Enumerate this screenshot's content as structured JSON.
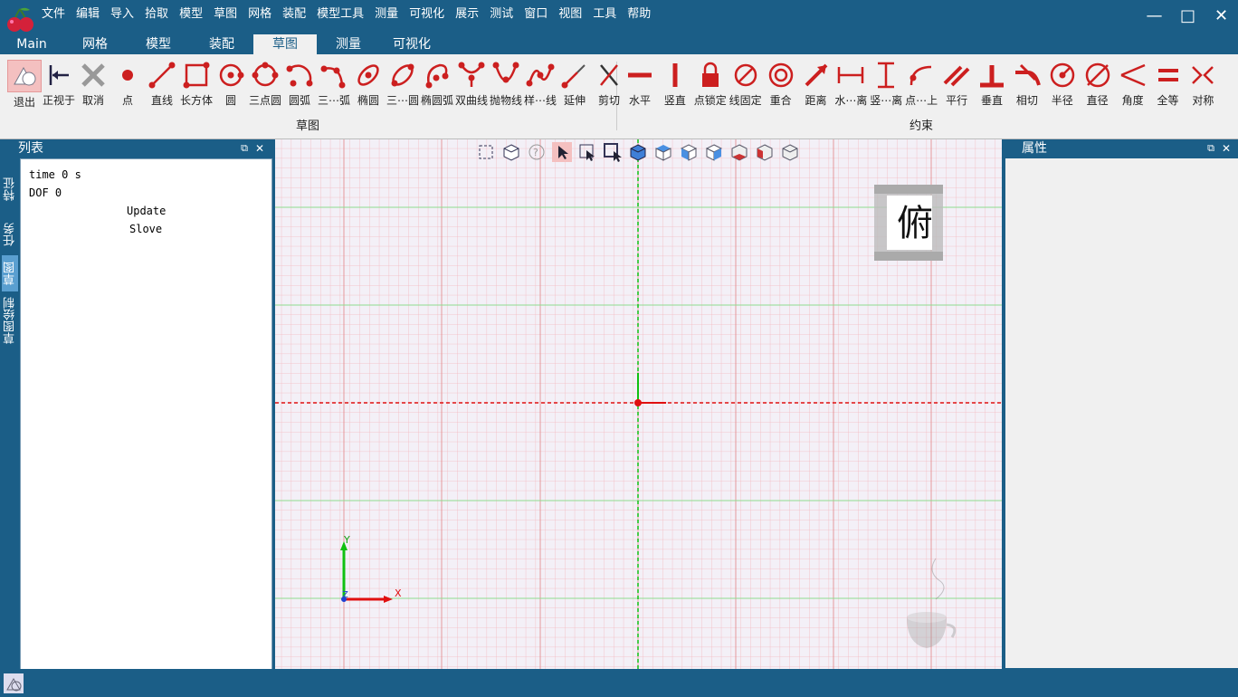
{
  "app": {
    "menu": [
      "文件",
      "编辑",
      "导入",
      "拾取",
      "模型",
      "草图",
      "网格",
      "装配",
      "模型工具",
      "测量",
      "可视化",
      "展示",
      "测试",
      "窗口",
      "视图",
      "工具",
      "帮助"
    ]
  },
  "tabs": [
    "Main",
    "网格",
    "模型",
    "装配",
    "草图",
    "测量",
    "可视化"
  ],
  "active_tab": "草图",
  "ribbon": {
    "sketch_group_label": "草图",
    "constraint_group_label": "约束",
    "sketch_buttons": [
      {
        "label": "退出",
        "icon": "exit-sketch-icon"
      },
      {
        "label": "正视于",
        "icon": "normal-to-icon"
      },
      {
        "label": "取消",
        "icon": "cancel-x-icon"
      },
      {
        "label": "点",
        "icon": "point-icon"
      },
      {
        "label": "直线",
        "icon": "line-icon"
      },
      {
        "label": "长方体",
        "icon": "rectangle-icon"
      },
      {
        "label": "圆",
        "icon": "circle-icon"
      },
      {
        "label": "三点圆",
        "icon": "three-point-circle-icon"
      },
      {
        "label": "圆弧",
        "icon": "arc-icon"
      },
      {
        "label": "三⋯弧",
        "icon": "three-point-arc-icon"
      },
      {
        "label": "椭圆",
        "icon": "ellipse-icon"
      },
      {
        "label": "三⋯圆",
        "icon": "three-point-ellipse-icon"
      },
      {
        "label": "椭圆弧",
        "icon": "ellipse-arc-icon"
      },
      {
        "label": "双曲线",
        "icon": "hyperbola-icon"
      },
      {
        "label": "抛物线",
        "icon": "parabola-icon"
      },
      {
        "label": "样⋯线",
        "icon": "spline-icon"
      },
      {
        "label": "延伸",
        "icon": "extend-icon"
      },
      {
        "label": "剪切",
        "icon": "trim-icon"
      }
    ],
    "constraint_buttons": [
      {
        "label": "水平",
        "icon": "horizontal-icon"
      },
      {
        "label": "竖直",
        "icon": "vertical-icon"
      },
      {
        "label": "点锁定",
        "icon": "lock-icon"
      },
      {
        "label": "线固定",
        "icon": "fix-line-icon"
      },
      {
        "label": "重合",
        "icon": "coincident-icon"
      },
      {
        "label": "距离",
        "icon": "distance-icon"
      },
      {
        "label": "水⋯离",
        "icon": "horizontal-distance-icon"
      },
      {
        "label": "竖⋯离",
        "icon": "vertical-distance-icon"
      },
      {
        "label": "点⋯上",
        "icon": "point-on-object-icon"
      },
      {
        "label": "平行",
        "icon": "parallel-icon"
      },
      {
        "label": "垂直",
        "icon": "perpendicular-icon"
      },
      {
        "label": "相切",
        "icon": "tangent-icon"
      },
      {
        "label": "半径",
        "icon": "radius-icon"
      },
      {
        "label": "直径",
        "icon": "diameter-icon"
      },
      {
        "label": "角度",
        "icon": "angle-icon"
      },
      {
        "label": "全等",
        "icon": "equal-icon"
      },
      {
        "label": "对称",
        "icon": "symmetric-icon"
      }
    ]
  },
  "left_dock_tabs": [
    "特征",
    "任务",
    "草图",
    "草图绘制"
  ],
  "list_panel": {
    "title": "列表",
    "lines": [
      "time 0 s",
      "DOF 0",
      "Update",
      "Slove"
    ]
  },
  "properties_panel": {
    "title": "属性"
  },
  "viewport": {
    "view_cube_label": "俯",
    "axis_x": "X",
    "axis_y": "Y",
    "axis_z": "Z"
  },
  "colors": {
    "frame": "#1b5e87",
    "ribbon": "#f0f0f0",
    "icon_red": "#cc1f1f",
    "grid_red": "#e88",
    "grid_green": "#8d8"
  }
}
